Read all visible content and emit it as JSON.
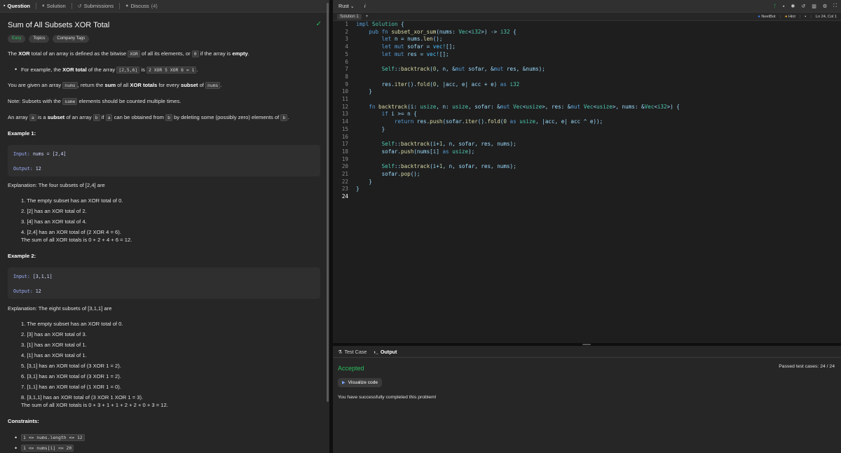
{
  "left_tabs": {
    "question": "Question",
    "solution": "Solution",
    "submissions": "Submissions",
    "discuss": "Discuss",
    "discuss_count": "(4)"
  },
  "problem": {
    "title": "Sum of All Subsets XOR Total",
    "tags": [
      "Easy",
      "Topics",
      "Company Tags"
    ],
    "p1": {
      "a": "The ",
      "b": "XOR",
      "c": " total of an array is defined as the bitwise ",
      "d": "XOR",
      "e": " of all its elements, or ",
      "f": "0",
      "g": " if the array is ",
      "h": "empty",
      "i": "."
    },
    "bullet1": {
      "a": "For example, the ",
      "b": "XOR total",
      "c": " of the array ",
      "d": "[2,5,6]",
      "e": " is ",
      "f": "2 XOR 5 XOR 6 = 1",
      "g": "."
    },
    "p2": {
      "a": "You are given an array ",
      "b": "nums",
      "c": ", return the ",
      "d": "sum",
      "e": " of all ",
      "f": "XOR totals",
      "g": " for every ",
      "h": "subset",
      "i": " of ",
      "j": "nums",
      "k": "."
    },
    "p3": {
      "a": "Note: Subsets with the ",
      "b": "same",
      "c": " elements should be counted multiple times."
    },
    "p4": {
      "a": "An array ",
      "b": "a",
      "c": " is a ",
      "d": "subset",
      "e": " of an array ",
      "f": "b",
      "g": " if ",
      "h": "a",
      "i": " can be obtained from ",
      "j": "b",
      "k": " by deleting some (possibly zero) elements of ",
      "l": "b",
      "m": "."
    },
    "example1": {
      "heading": "Example 1:",
      "input_label": "Input:",
      "input": "nums = [2,4]",
      "output_label": "Output:",
      "output": "12",
      "explanation": "Explanation: The four subsets of [2,4] are",
      "items": [
        "1. The empty subset has an XOR total of 0.",
        "2. [2] has an XOR total of 2.",
        "3. [4] has an XOR total of 4.",
        "4. [2,4] has an XOR total of (2 XOR 4 = 6)."
      ],
      "sum": "The sum of all XOR totals is 0 + 2 + 4 + 6 = 12."
    },
    "example2": {
      "heading": "Example 2:",
      "input_label": "Input:",
      "input": "[3,1,1]",
      "output_label": "Output:",
      "output": "12",
      "explanation": "Explanation: The eight subsets of [3,1,1] are",
      "items": [
        "1. The empty subset has an XOR total of 0.",
        "2. [3] has an XOR total of 3.",
        "3. [1] has an XOR total of 1.",
        "4. [1] has an XOR total of 1.",
        "5. [3,1] has an XOR total of (3 XOR 1 = 2).",
        "6. [3,1] has an XOR total of (3 XOR 1 = 2).",
        "7. [1,1] has an XOR total of (1 XOR 1 = 0).",
        "8. [3,1,1] has an XOR total of (3 XOR 1 XOR 1 = 3)."
      ],
      "sum": "The sum of all XOR totals is 0 + 3 + 1 + 1 + 2 + 2 + 0 + 3 = 12."
    },
    "constraints_heading": "Constraints:",
    "constraints": [
      "1 <= nums.length <= 12",
      "1 <= nums[i] <= 20"
    ]
  },
  "editor": {
    "language": "Rust",
    "info_icon": "i",
    "tab": "Solution 1",
    "add": "+",
    "neetbot": "NeetBot",
    "hint": "Hint",
    "cursor": "Ln 24, Col 1",
    "lines": [
      "impl Solution {",
      "    pub fn subset_xor_sum(nums: Vec<i32>) -> i32 {",
      "        let n = nums.len();",
      "        let mut sofar = vec![];",
      "        let mut res = vec![];",
      "",
      "        Self::backtrack(0, n, &mut sofar, &mut res, &nums);",
      "",
      "        res.iter().fold(0, |acc, e| acc + e) as i32",
      "    }",
      "",
      "    fn backtrack(i: usize, n: usize, sofar: &mut Vec<usize>, res: &mut Vec<usize>, nums: &Vec<i32>) {",
      "        if i >= n {",
      "            return res.push(sofar.iter().fold(0 as usize, |acc, e| acc ^ e));",
      "        }",
      "",
      "        Self::backtrack(i+1, n, sofar, res, nums);",
      "        sofar.push(nums[i] as usize);",
      "",
      "        Self::backtrack(i+1, n, sofar, res, nums);",
      "        sofar.pop();",
      "    }",
      "}",
      ""
    ]
  },
  "result": {
    "test_case_tab": "Test Case",
    "output_tab": "Output",
    "status": "Accepted",
    "passed": "Passed test cases: 24 / 24",
    "visualize": "Visualize code",
    "message": "You have successfully completed this problem!"
  }
}
